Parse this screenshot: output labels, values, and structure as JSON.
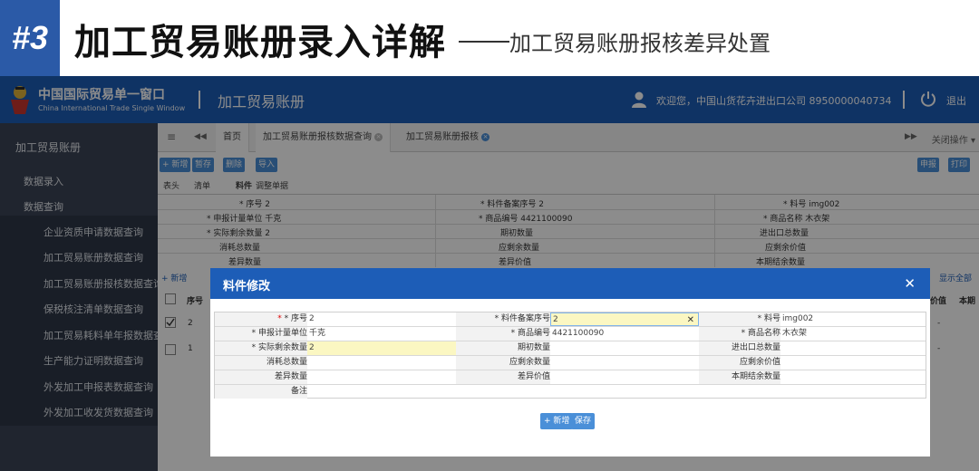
{
  "slide": {
    "badge": "#3",
    "title": "加工贸易账册录入详解",
    "subtitle": "加工贸易账册报核差异处置"
  },
  "app": {
    "logo_cn": "中国国际贸易单一窗口",
    "logo_en": "China International Trade Single Window",
    "system_name": "加工贸易账册",
    "welcome": "欢迎您，中国山货花卉进出口公司 8950000040734",
    "logout": "退出"
  },
  "sidebar": {
    "title": "加工贸易账册",
    "items": [
      "数据录入",
      "数据查询"
    ],
    "sub_items": [
      "企业资质申请数据查询",
      "加工贸易账册数据查询",
      "加工贸易账册报核数据查询",
      "保税核注清单数据查询",
      "加工贸易耗料单年报数据查询",
      "生产能力证明数据查询",
      "外发加工申报表数据查询",
      "外发加工收发货数据查询"
    ]
  },
  "tabbar": {
    "menu_glyph": "≡",
    "back_glyph": "◀◀",
    "tabs": [
      "首页",
      "加工贸易账册报核数据查询",
      "加工贸易账册报核"
    ],
    "forward_glyph": "▶▶",
    "close_ops": "关闭操作 ▾"
  },
  "toolbar": {
    "add": "+ 新增",
    "save": "暂存",
    "delete": "删除",
    "import": "导入",
    "declare": "申报",
    "print": "打印"
  },
  "subtabs": [
    "表头",
    "清单",
    "料件",
    "调整单据"
  ],
  "bg_form": {
    "rows": [
      [
        "* 序号 2",
        "* 料件备案序号 2",
        "* 料号 img002"
      ],
      [
        "* 申报计量单位 千克",
        "* 商品编号 4421100090",
        "* 商品名称 木衣架"
      ],
      [
        "* 实际剩余数量 2",
        "期初数量",
        "进出口总数量"
      ],
      [
        "消耗总数量",
        "应剩余数量",
        "应剩余价值"
      ],
      [
        "差异数量",
        "差异价值",
        "本期结余数量"
      ]
    ]
  },
  "bg_list": {
    "add": "+ 新增",
    "show_all": "显示全部",
    "col_seq": "序号",
    "col_price": "价值",
    "col_current": "本期",
    "rows": [
      "2",
      "1"
    ],
    "dash": "-"
  },
  "modal": {
    "title": "料件修改",
    "close": "✕",
    "fields": {
      "seq_label": "* 序号",
      "seq_value": "2",
      "mat_seq_label": "* 料件备案序号",
      "mat_seq_value": "2",
      "part_no_label": "* 料号",
      "part_no_value": "img002",
      "unit_label": "* 申报计量单位",
      "unit_value": "千克",
      "hs_label": "* 商品编号",
      "hs_value": "4421100090",
      "goods_label": "* 商品名称",
      "goods_value": "木衣架",
      "actual_rem_label": "* 实际剩余数量",
      "actual_rem_value": "2",
      "opening_label": "期初数量",
      "opening_value": "",
      "io_total_label": "进出口总数量",
      "io_total_value": "",
      "consume_label": "消耗总数量",
      "consume_value": "",
      "should_rem_label": "应剩余数量",
      "should_rem_value": "",
      "should_rem_val_label": "应剩余价值",
      "should_rem_val_value": "",
      "diff_qty_label": "差异数量",
      "diff_qty_value": "",
      "diff_val_label": "差异价值",
      "diff_val_value": "",
      "period_bal_label": "本期结余数量",
      "period_bal_value": "",
      "remark_label": "备注",
      "remark_value": ""
    },
    "buttons": {
      "add": "+ 新增",
      "save": "保存"
    }
  }
}
